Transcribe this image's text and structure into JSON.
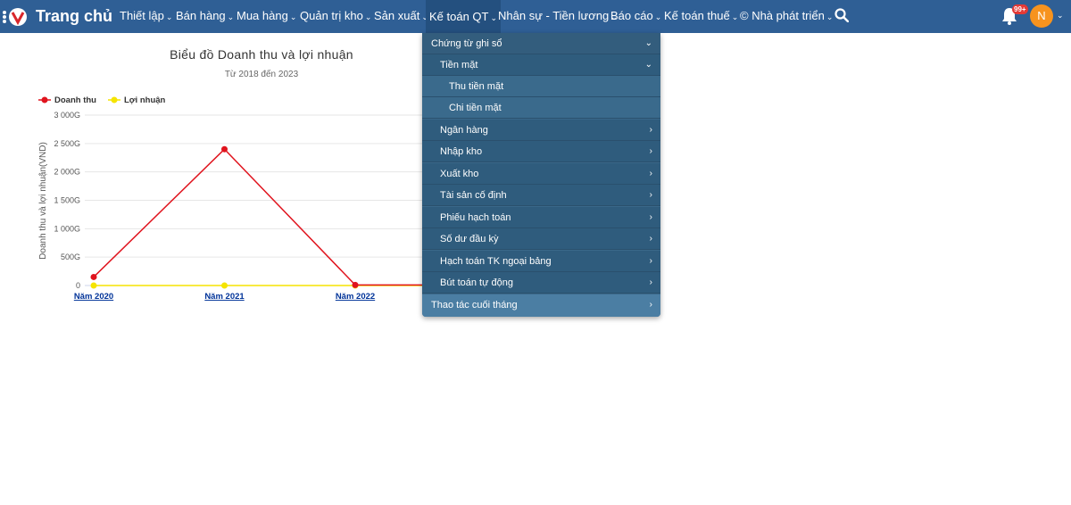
{
  "nav": {
    "home": "Trang chủ",
    "items": [
      {
        "label": "Thiết lập"
      },
      {
        "label": "Bán hàng"
      },
      {
        "label": "Mua hàng"
      },
      {
        "label": "Quản trị kho"
      },
      {
        "label": "Sản xuất"
      },
      {
        "label": "Kế toán QT"
      },
      {
        "label": "Nhân sự - Tiền lương"
      },
      {
        "label": "Báo cáo"
      },
      {
        "label": "Kế toán thuế"
      },
      {
        "label": "© Nhà phát triển"
      }
    ],
    "notification_count": "99+",
    "avatar_initial": "N",
    "chevron": "⌄"
  },
  "menu": {
    "items": [
      {
        "label": "Chứng từ ghi sổ",
        "arrow": "⌄"
      },
      {
        "label": "Tiền mặt",
        "arrow": "⌄"
      },
      {
        "label": "Thu tiền mặt"
      },
      {
        "label": "Chi tiền mặt"
      },
      {
        "label": "Ngân hàng",
        "arrow": "›"
      },
      {
        "label": "Nhập kho",
        "arrow": "›"
      },
      {
        "label": "Xuất kho",
        "arrow": "›"
      },
      {
        "label": "Tài sản cố định",
        "arrow": "›"
      },
      {
        "label": "Phiếu hạch toán",
        "arrow": "›"
      },
      {
        "label": "Số dư đầu kỳ",
        "arrow": "›"
      },
      {
        "label": "Hạch toán TK ngoại bảng",
        "arrow": "›"
      },
      {
        "label": "Bút toán tự động",
        "arrow": "›"
      },
      {
        "label": "Thao tác cuối tháng",
        "arrow": "›"
      }
    ]
  },
  "chart_data": {
    "type": "line",
    "title": "Biểu đồ Doanh thu và lợi nhuận",
    "subtitle": "Từ 2018 đến 2023",
    "ylabel": "Doanh thu và lợi nhuận(VND)",
    "ylim": [
      0,
      3000
    ],
    "yticks": [
      "0",
      "500G",
      "1 000G",
      "1 500G",
      "2 000G",
      "2 500G",
      "3 000G"
    ],
    "categories": [
      "Năm 2020",
      "Năm 2021",
      "Năm 2022"
    ],
    "legend_position": "top-left",
    "series": [
      {
        "name": "Doanh thu",
        "color": "#e0141e",
        "values": [
          150,
          2400,
          10
        ]
      },
      {
        "name": "Lợi nhuận",
        "color": "#f5e400",
        "values": [
          0,
          0,
          0
        ]
      }
    ]
  }
}
